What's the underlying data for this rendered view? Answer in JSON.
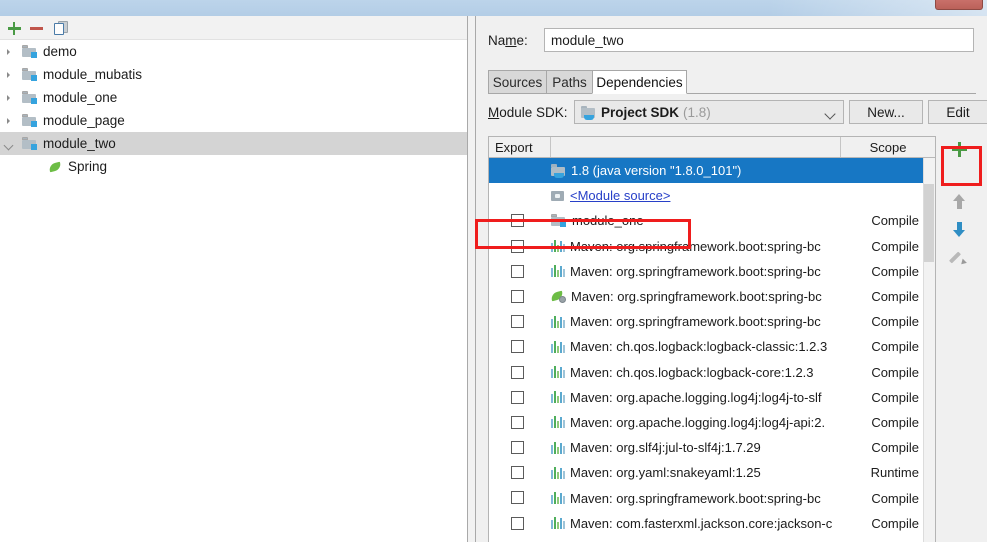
{
  "window": {
    "close_button": "close-button"
  },
  "left_panel": {
    "toolbar": [
      {
        "name": "add-module-button",
        "icon": "plus-icon",
        "label": "+"
      },
      {
        "name": "remove-module-button",
        "icon": "minus-icon",
        "label": "−"
      },
      {
        "name": "copy-module-button",
        "icon": "copy-icon",
        "label": "Copy"
      }
    ],
    "tree": [
      {
        "label": "demo",
        "icon": "module-folder-icon",
        "expanded": false,
        "selected": false,
        "indent": 0
      },
      {
        "label": "module_mubatis",
        "icon": "module-folder-icon",
        "expanded": false,
        "selected": false,
        "indent": 0
      },
      {
        "label": "module_one",
        "icon": "module-folder-icon",
        "expanded": false,
        "selected": false,
        "indent": 0
      },
      {
        "label": "module_page",
        "icon": "module-folder-icon",
        "expanded": false,
        "selected": false,
        "indent": 0
      },
      {
        "label": "module_two",
        "icon": "module-folder-icon",
        "expanded": true,
        "selected": true,
        "indent": 0
      },
      {
        "label": "Spring",
        "icon": "spring-leaf-icon",
        "expanded": null,
        "selected": false,
        "indent": 1
      }
    ]
  },
  "right_panel": {
    "name_field": {
      "label": "Name:",
      "label_pre": "Na",
      "label_mnemonic": "m",
      "label_post": "e:",
      "value": "module_two",
      "placeholder": ""
    },
    "tabs": [
      {
        "label": "Sources",
        "active": false
      },
      {
        "label": "Paths",
        "active": false
      },
      {
        "label": "Dependencies",
        "active": true
      }
    ],
    "module_sdk": {
      "label": "Module SDK:",
      "label_mnemonic": "M",
      "label_rest": "odule SDK:",
      "selected": "Project SDK",
      "selected_version": "(1.8)",
      "icon": "sdk-folder-icon",
      "dropdown_icon": "chevron-down-icon",
      "new_button": "New...",
      "edit_button": "Edit"
    },
    "table": {
      "columns": [
        "Export",
        "",
        "Scope"
      ],
      "rows": [
        {
          "checkbox": null,
          "icon": "sdk-icon",
          "text": "1.8 (java version \"1.8.0_101\")",
          "scope": "",
          "selected": true,
          "link": false,
          "caret": false
        },
        {
          "checkbox": null,
          "icon": "module-source-icon",
          "text": "<Module source>",
          "scope": "",
          "selected": false,
          "link": true,
          "caret": false
        },
        {
          "checkbox": false,
          "icon": "module-folder-icon",
          "text": "module_one",
          "scope": "Compile",
          "selected": false,
          "link": false,
          "caret": true
        },
        {
          "checkbox": false,
          "icon": "jar-icon",
          "text": "Maven: org.springframework.boot:spring-bc",
          "scope": "Compile",
          "selected": false,
          "link": false,
          "caret": true
        },
        {
          "checkbox": false,
          "icon": "jar-icon",
          "text": "Maven: org.springframework.boot:spring-bc",
          "scope": "Compile",
          "selected": false,
          "link": false,
          "caret": true
        },
        {
          "checkbox": false,
          "icon": "spring-jar-icon",
          "text": "Maven: org.springframework.boot:spring-bc",
          "scope": "Compile",
          "selected": false,
          "link": false,
          "caret": true
        },
        {
          "checkbox": false,
          "icon": "jar-icon",
          "text": "Maven: org.springframework.boot:spring-bc",
          "scope": "Compile",
          "selected": false,
          "link": false,
          "caret": true
        },
        {
          "checkbox": false,
          "icon": "jar-icon",
          "text": "Maven: ch.qos.logback:logback-classic:1.2.3",
          "scope": "Compile",
          "selected": false,
          "link": false,
          "caret": true
        },
        {
          "checkbox": false,
          "icon": "jar-icon",
          "text": "Maven: ch.qos.logback:logback-core:1.2.3",
          "scope": "Compile",
          "selected": false,
          "link": false,
          "caret": true
        },
        {
          "checkbox": false,
          "icon": "jar-icon",
          "text": "Maven: org.apache.logging.log4j:log4j-to-slf",
          "scope": "Compile",
          "selected": false,
          "link": false,
          "caret": true
        },
        {
          "checkbox": false,
          "icon": "jar-icon",
          "text": "Maven: org.apache.logging.log4j:log4j-api:2.",
          "scope": "Compile",
          "selected": false,
          "link": false,
          "caret": true
        },
        {
          "checkbox": false,
          "icon": "jar-icon",
          "text": "Maven: org.slf4j:jul-to-slf4j:1.7.29",
          "scope": "Compile",
          "selected": false,
          "link": false,
          "caret": true
        },
        {
          "checkbox": false,
          "icon": "jar-icon",
          "text": "Maven: org.yaml:snakeyaml:1.25",
          "scope": "Runtime",
          "selected": false,
          "link": false,
          "caret": true
        },
        {
          "checkbox": false,
          "icon": "jar-icon",
          "text": "Maven: org.springframework.boot:spring-bc",
          "scope": "Compile",
          "selected": false,
          "link": false,
          "caret": true
        },
        {
          "checkbox": false,
          "icon": "jar-icon",
          "text": "Maven: com.fasterxml.jackson.core:jackson-c",
          "scope": "Compile",
          "selected": false,
          "link": false,
          "caret": true
        }
      ]
    },
    "side_toolbar": [
      {
        "name": "add-dependency-button",
        "icon": "plus-icon",
        "highlighted": true
      },
      {
        "name": "move-up-button",
        "icon": "arrow-up-icon",
        "highlighted": false
      },
      {
        "name": "move-down-button",
        "icon": "arrow-down-icon",
        "highlighted": false
      },
      {
        "name": "edit-dependency-button",
        "icon": "pencil-icon",
        "highlighted": false
      }
    ]
  },
  "annotations": {
    "highlight_color": "#ef1d1d",
    "boxes": [
      "add-dependency-button",
      "module-one-row"
    ]
  },
  "colors": {
    "selection_blue": "#1777c4",
    "tree_selection": "#d4d4d4",
    "accent_green": "#4a9a45",
    "accent_red": "#c0554b",
    "link_blue": "#2840c8",
    "titlebar": "#b7d0e8"
  }
}
